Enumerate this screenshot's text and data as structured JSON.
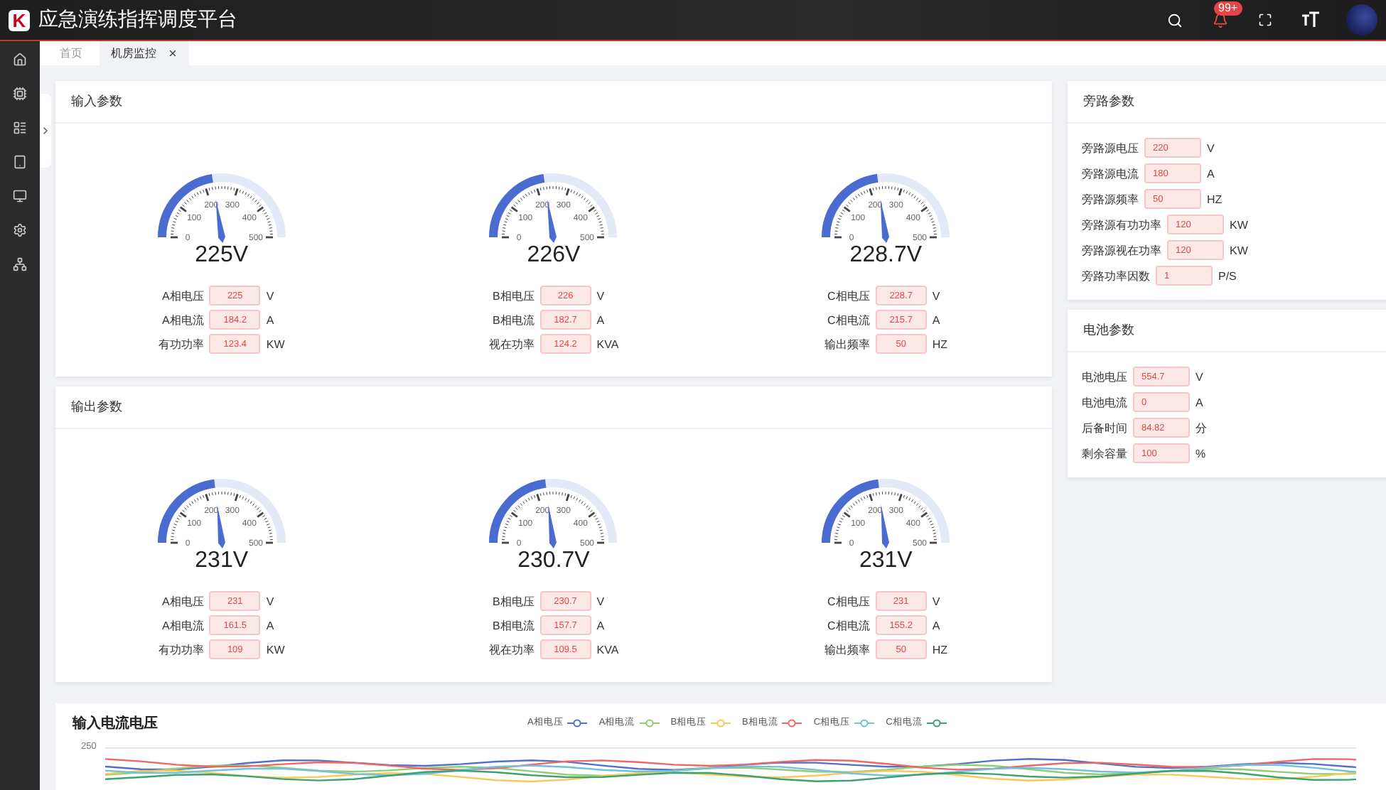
{
  "header": {
    "logo": "K",
    "title": "应急演练指挥调度平台",
    "badge": "99+"
  },
  "tabs": [
    {
      "label": "首页",
      "selected": false,
      "closable": false
    },
    {
      "label": "机房监控",
      "selected": true,
      "closable": true
    }
  ],
  "input_panel": {
    "title": "输入参数",
    "gauges": [
      {
        "reading": "225V",
        "level": 0.45,
        "scale": [
          "0",
          "100",
          "200",
          "300",
          "400",
          "500"
        ],
        "rows": [
          {
            "label": "A相电压",
            "value": "225",
            "unit": "V"
          },
          {
            "label": "A相电流",
            "value": "184.2",
            "unit": "A"
          },
          {
            "label": "有功功率",
            "value": "123.4",
            "unit": "KW"
          }
        ]
      },
      {
        "reading": "226V",
        "level": 0.452,
        "scale": [
          "0",
          "100",
          "200",
          "300",
          "400",
          "500"
        ],
        "rows": [
          {
            "label": "B相电压",
            "value": "226",
            "unit": "V"
          },
          {
            "label": "B相电流",
            "value": "182.7",
            "unit": "A"
          },
          {
            "label": "视在功率",
            "value": "124.2",
            "unit": "KVA"
          }
        ]
      },
      {
        "reading": "228.7V",
        "level": 0.457,
        "scale": [
          "0",
          "100",
          "200",
          "300",
          "400",
          "500"
        ],
        "rows": [
          {
            "label": "C相电压",
            "value": "228.7",
            "unit": "V"
          },
          {
            "label": "C相电流",
            "value": "215.7",
            "unit": "A"
          },
          {
            "label": "输出频率",
            "value": "50",
            "unit": "HZ"
          }
        ]
      }
    ]
  },
  "output_panel": {
    "title": "输出参数",
    "gauges": [
      {
        "reading": "231V",
        "level": 0.462,
        "scale": [
          "0",
          "100",
          "200",
          "300",
          "400",
          "500"
        ],
        "rows": [
          {
            "label": "A相电压",
            "value": "231",
            "unit": "V"
          },
          {
            "label": "A相电流",
            "value": "161.5",
            "unit": "A"
          },
          {
            "label": "有功功率",
            "value": "109",
            "unit": "KW"
          }
        ]
      },
      {
        "reading": "230.7V",
        "level": 0.461,
        "scale": [
          "0",
          "100",
          "200",
          "300",
          "400",
          "500"
        ],
        "rows": [
          {
            "label": "B相电压",
            "value": "230.7",
            "unit": "V"
          },
          {
            "label": "B相电流",
            "value": "157.7",
            "unit": "A"
          },
          {
            "label": "视在功率",
            "value": "109.5",
            "unit": "KVA"
          }
        ]
      },
      {
        "reading": "231V",
        "level": 0.462,
        "scale": [
          "0",
          "100",
          "200",
          "300",
          "400",
          "500"
        ],
        "rows": [
          {
            "label": "C相电压",
            "value": "231",
            "unit": "V"
          },
          {
            "label": "C相电流",
            "value": "155.2",
            "unit": "A"
          },
          {
            "label": "输出频率",
            "value": "50",
            "unit": "HZ"
          }
        ]
      }
    ]
  },
  "bypass_panel": {
    "title": "旁路参数",
    "rows": [
      {
        "label": "旁路源电压",
        "value": "220",
        "unit": "V"
      },
      {
        "label": "旁路源电流",
        "value": "180",
        "unit": "A"
      },
      {
        "label": "旁路源频率",
        "value": "50",
        "unit": "HZ"
      },
      {
        "label": "旁路源有功功率",
        "value": "120",
        "unit": "KW"
      },
      {
        "label": "旁路源视在功率",
        "value": "120",
        "unit": "KW"
      },
      {
        "label": "旁路功率因数",
        "value": "1",
        "unit": "P/S"
      }
    ]
  },
  "battery_panel": {
    "title": "电池参数",
    "rows": [
      {
        "label": "电池电压",
        "value": "554.7",
        "unit": "V"
      },
      {
        "label": "电池电流",
        "value": "0",
        "unit": "A"
      },
      {
        "label": "后备时间",
        "value": "84.82",
        "unit": "分"
      },
      {
        "label": "剩余容量",
        "value": "100",
        "unit": "%"
      }
    ]
  },
  "chart_panel": {
    "title": "输入电流电压",
    "y_tick": "250",
    "legend": [
      {
        "name": "A相电压",
        "color": "#5470c6"
      },
      {
        "name": "A相电流",
        "color": "#91cc75"
      },
      {
        "name": "B相电压",
        "color": "#fac858"
      },
      {
        "name": "B相电流",
        "color": "#ee6666"
      },
      {
        "name": "C相电压",
        "color": "#73c0de"
      },
      {
        "name": "C相电流",
        "color": "#3ba272"
      }
    ]
  }
}
